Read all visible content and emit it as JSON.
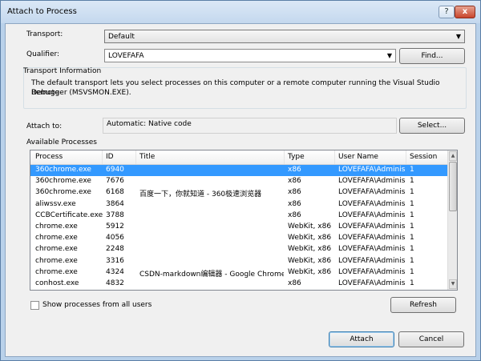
{
  "window": {
    "title": "Attach to Process",
    "help_glyph": "?",
    "close_glyph": "x"
  },
  "transport": {
    "label": "Transport:",
    "value": "Default"
  },
  "qualifier": {
    "label": "Qualifier:",
    "value": "LOVEFAFA",
    "find_label": "Find..."
  },
  "transport_info": {
    "title": "Transport Information",
    "line1": "The default transport lets you select processes on this computer or a remote computer running the Visual Studio Remote",
    "line2": "Debugger (MSVSMON.EXE)."
  },
  "attach_to": {
    "label": "Attach to:",
    "value": "Automatic: Native code",
    "select_label": "Select..."
  },
  "available": {
    "title": "Available Processes",
    "columns": [
      "Process",
      "ID",
      "Title",
      "Type",
      "User Name",
      "Session"
    ],
    "rows": [
      {
        "process": "360chrome.exe",
        "id": "6940",
        "title": "",
        "type": "x86",
        "user": "LOVEFAFA\\Adminis...",
        "session": "1"
      },
      {
        "process": "360chrome.exe",
        "id": "7676",
        "title": "",
        "type": "x86",
        "user": "LOVEFAFA\\Adminis...",
        "session": "1"
      },
      {
        "process": "360chrome.exe",
        "id": "6168",
        "title": "百度一下，你就知道 - 360极速浏览器",
        "type": "x86",
        "user": "LOVEFAFA\\Adminis...",
        "session": "1"
      },
      {
        "process": "aliwssv.exe",
        "id": "3864",
        "title": "",
        "type": "x86",
        "user": "LOVEFAFA\\Adminis...",
        "session": "1"
      },
      {
        "process": "CCBCertificate.exe",
        "id": "3788",
        "title": "",
        "type": "x86",
        "user": "LOVEFAFA\\Adminis...",
        "session": "1"
      },
      {
        "process": "chrome.exe",
        "id": "5912",
        "title": "",
        "type": "WebKit, x86",
        "user": "LOVEFAFA\\Adminis...",
        "session": "1"
      },
      {
        "process": "chrome.exe",
        "id": "4056",
        "title": "",
        "type": "WebKit, x86",
        "user": "LOVEFAFA\\Adminis...",
        "session": "1"
      },
      {
        "process": "chrome.exe",
        "id": "2248",
        "title": "",
        "type": "WebKit, x86",
        "user": "LOVEFAFA\\Adminis...",
        "session": "1"
      },
      {
        "process": "chrome.exe",
        "id": "3316",
        "title": "",
        "type": "WebKit, x86",
        "user": "LOVEFAFA\\Adminis...",
        "session": "1"
      },
      {
        "process": "chrome.exe",
        "id": "4324",
        "title": "CSDN-markdown编辑器 - Google Chrome",
        "type": "WebKit, x86",
        "user": "LOVEFAFA\\Adminis...",
        "session": "1"
      },
      {
        "process": "conhost.exe",
        "id": "4832",
        "title": "",
        "type": "x86",
        "user": "LOVEFAFA\\Adminis...",
        "session": "1"
      }
    ],
    "selected_index": 0
  },
  "show_all": {
    "label": "Show processes from all users",
    "checked": false
  },
  "refresh_label": "Refresh",
  "attach_label": "Attach",
  "cancel_label": "Cancel",
  "colors": {
    "selection": "#3399ff",
    "titlebar": "#c4d8ee",
    "client": "#f0f0f0"
  }
}
